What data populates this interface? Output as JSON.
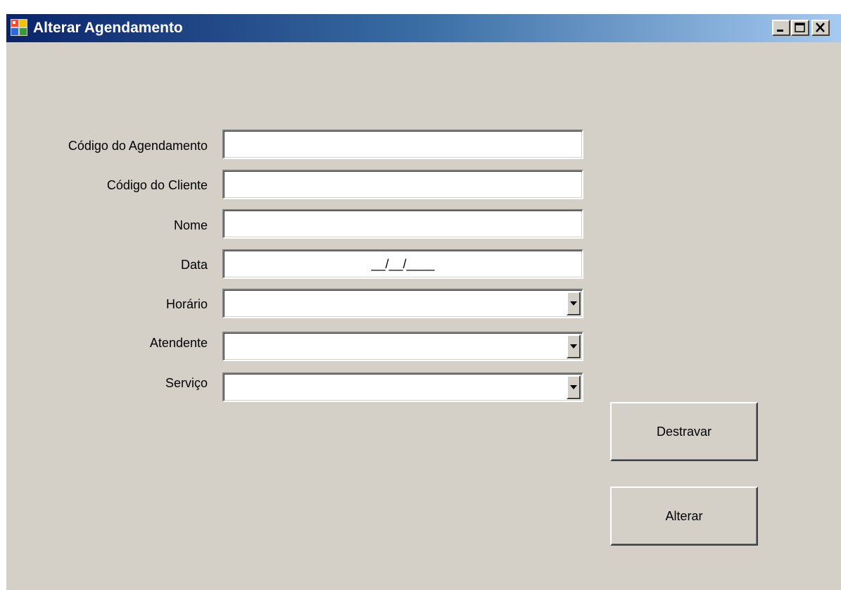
{
  "window": {
    "title": "Alterar Agendamento",
    "icon": "application-form-icon",
    "controls": {
      "minimize": "minimize-icon",
      "maximize": "maximize-icon",
      "close": "close-icon"
    }
  },
  "form": {
    "fields": {
      "codigo_agendamento": {
        "label": "Código do Agendamento",
        "value": ""
      },
      "codigo_cliente": {
        "label": "Código do Cliente",
        "value": ""
      },
      "nome": {
        "label": "Nome",
        "value": ""
      },
      "data": {
        "label": "Data",
        "value": "__/__/____"
      },
      "horario": {
        "label": "Horário",
        "value": ""
      },
      "atendente": {
        "label": "Atendente",
        "value": ""
      },
      "servico": {
        "label": "Serviço",
        "value": ""
      }
    },
    "buttons": {
      "destravar": "Destravar",
      "alterar": "Alterar"
    }
  },
  "colors": {
    "window_background": "#d4d0c8",
    "titlebar_start": "#0a246a",
    "titlebar_end": "#a6caf0",
    "title_text": "#ffffff"
  }
}
